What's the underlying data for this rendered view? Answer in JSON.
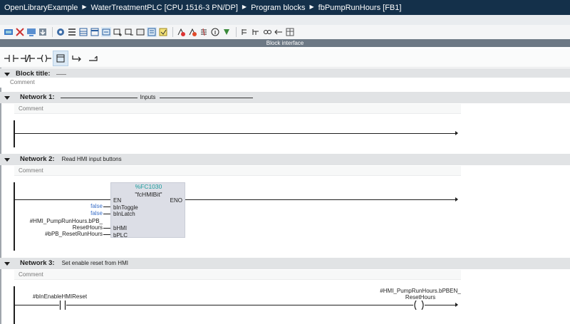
{
  "breadcrumb": [
    "OpenLibraryExample",
    "WaterTreatmentPLC [CPU 1516-3 PN/DP]",
    "Program blocks",
    "fbPumpRunHours [FB1]"
  ],
  "toolbar_icons": [
    "go-online-icon",
    "close-icon",
    "monitor-icon",
    "download-icon",
    "settings-icon",
    "list-icon",
    "grid-icon",
    "compare-icon",
    "display-icon",
    "insert-network-icon",
    "delete-network-icon",
    "insert-row-icon",
    "bookmark-icon",
    "toggle-icon",
    "error-icon",
    "warning-icon",
    "jump-icon",
    "info-icon",
    "test-icon",
    "breakpoint-icon",
    "goto-icon",
    "watch-icon",
    "debug-icon",
    "table-icon"
  ],
  "block_interface_label": "Block interface",
  "ladder_buttons": [
    "no-contact-icon",
    "nc-contact-icon",
    "coil-icon",
    "box-icon",
    "open-branch-icon",
    "close-branch-icon"
  ],
  "block_title": {
    "label": "Block title:",
    "comment": "Comment"
  },
  "networks": [
    {
      "label": "Network 1:",
      "title": "Inputs",
      "comment": "Comment"
    },
    {
      "label": "Network 2:",
      "title": "Read HMI input buttons",
      "comment": "Comment",
      "fc": {
        "number": "%FC1030",
        "name": "\"fcHMIBit\"",
        "en": "EN",
        "eno": "ENO",
        "pins": [
          {
            "name": "bInToggle",
            "value": "false"
          },
          {
            "name": "bInLatch",
            "value": "false"
          },
          {
            "name": "bHMI",
            "value_line1": "#HMI_PumpRunHours.bPB_",
            "value_line2": "ResetHours"
          },
          {
            "name": "bPLC",
            "value": "#bPB_ResetRunHours"
          }
        ]
      }
    },
    {
      "label": "Network 3:",
      "title": "Set enable reset from HMI",
      "comment": "Comment",
      "contact": "#bInEnableHMIReset",
      "coil_line1": "#HMI_PumpRunHours.bPBEN_",
      "coil_line2": "ResetHours"
    }
  ]
}
